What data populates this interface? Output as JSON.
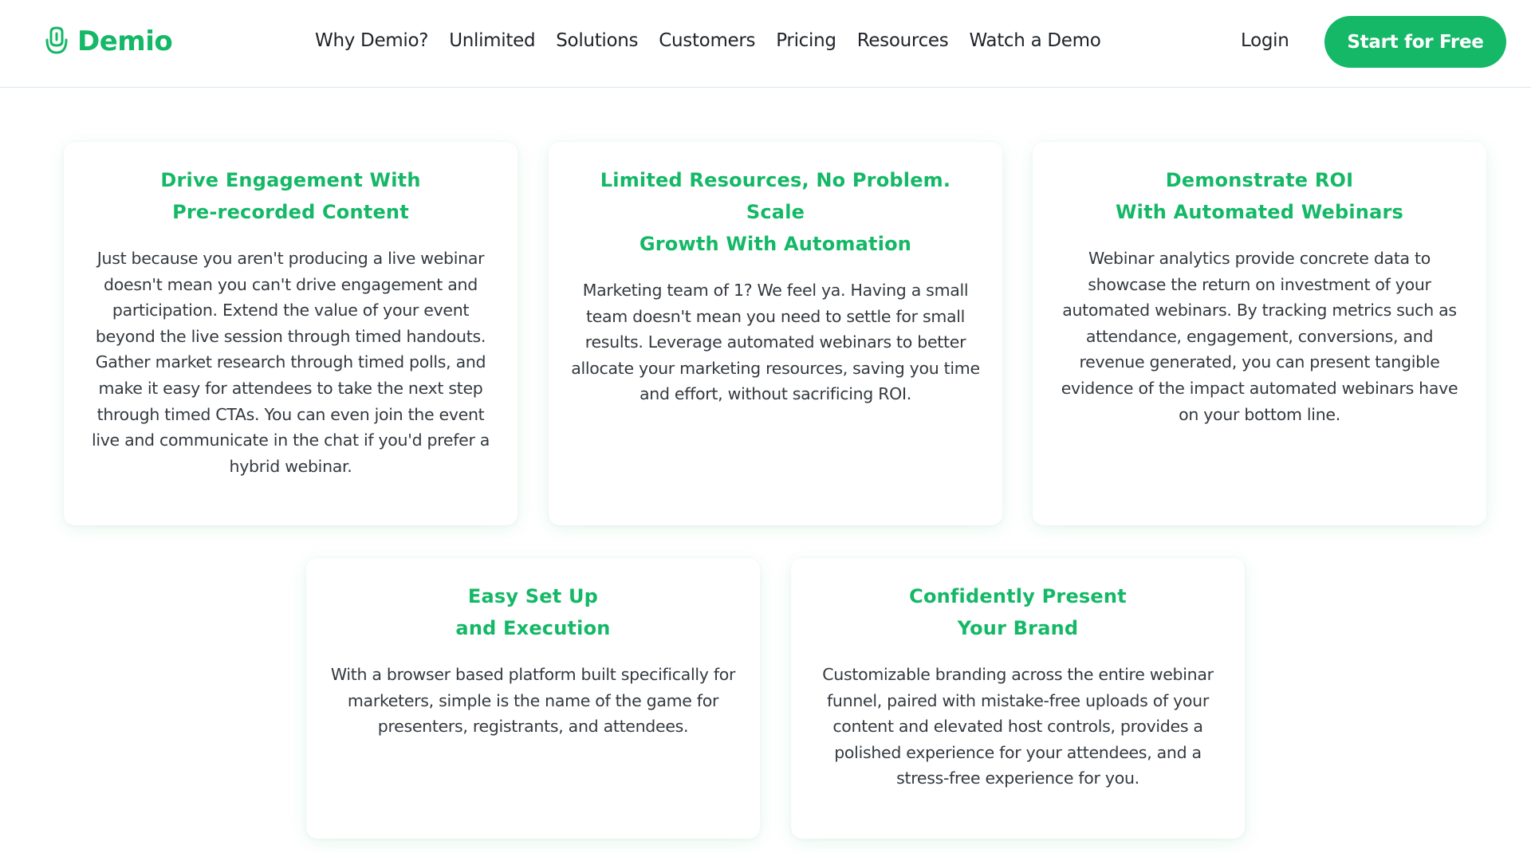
{
  "brand": {
    "name": "Demio",
    "accent": "#14b866"
  },
  "nav": {
    "items": [
      "Why Demio?",
      "Unlimited",
      "Solutions",
      "Customers",
      "Pricing",
      "Resources",
      "Watch a Demo"
    ],
    "login": "Login",
    "cta": "Start for Free"
  },
  "cards": [
    {
      "title_line1": "Drive Engagement With",
      "title_line2": "Pre-recorded Content",
      "body": "Just because you aren't producing a live webinar doesn't mean you can't drive engagement and participation. Extend the value of your event beyond the live session through timed handouts. Gather market research through timed polls, and make it easy for attendees to take the next step through timed CTAs. You can even join the event live and communicate in the chat if you'd prefer a hybrid webinar."
    },
    {
      "title_line1": "Limited Resources, No Problem. Scale",
      "title_line2": "Growth With Automation",
      "body": "Marketing team of 1? We feel ya. Having a small team doesn't mean you need to settle for small results. Leverage automated webinars to better allocate your marketing resources, saving you time and effort, without sacrificing ROI."
    },
    {
      "title_line1": "Demonstrate ROI",
      "title_line2": "With Automated Webinars",
      "body": "Webinar analytics provide concrete data to showcase the return on investment of your automated webinars. By tracking metrics such as attendance, engagement, conversions, and revenue generated, you can present tangible evidence of the impact automated webinars have on your bottom line."
    },
    {
      "title_line1": "Easy Set Up",
      "title_line2": "and Execution",
      "body": "With a browser based platform built specifically for marketers, simple is the name of the game for presenters, registrants, and attendees."
    },
    {
      "title_line1": "Confidently Present",
      "title_line2": "Your Brand",
      "body": "Customizable branding across the entire webinar funnel, paired with mistake-free uploads of your content and elevated host controls, provides a polished experience for your attendees, and a stress-free experience for you."
    }
  ]
}
